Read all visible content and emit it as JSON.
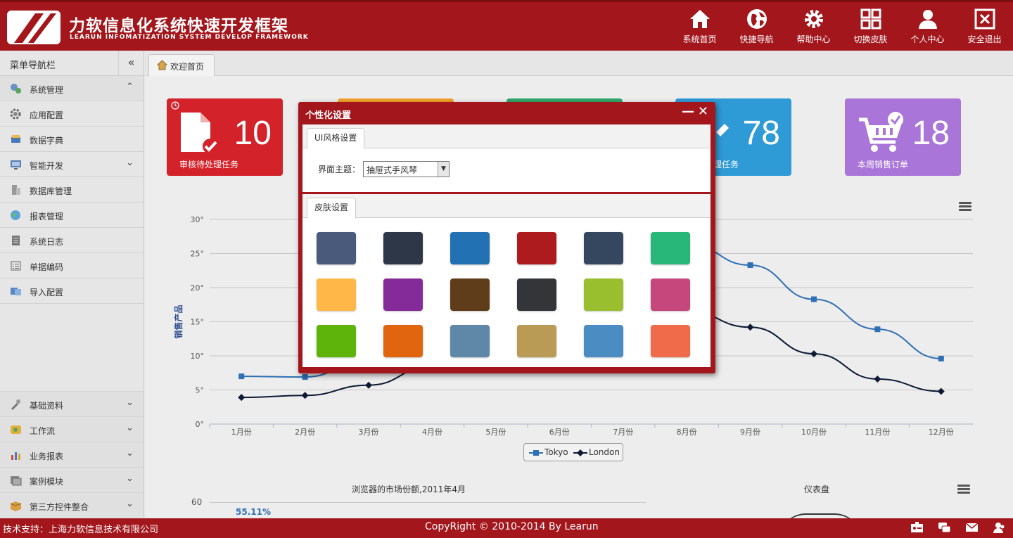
{
  "header": {
    "title": "力软信息化系统快速开发框架",
    "subtitle": "LEARUN INFOMATIZATION SYSTEM DEVELOP FRAMEWORK",
    "nav": [
      {
        "label": "系统首页",
        "icon": "home-icon"
      },
      {
        "label": "快捷导航",
        "icon": "globe-icon"
      },
      {
        "label": "帮助中心",
        "icon": "gear-icon"
      },
      {
        "label": "切换皮肤",
        "icon": "grid-icon"
      },
      {
        "label": "个人中心",
        "icon": "user-icon"
      },
      {
        "label": "安全退出",
        "icon": "exit-icon"
      }
    ]
  },
  "sidebar": {
    "title": "菜单导航栏",
    "collapse_label": "«",
    "items": [
      {
        "label": "系统管理",
        "chevron": "⌃"
      },
      {
        "label": "应用配置",
        "chevron": ""
      },
      {
        "label": "数据字典",
        "chevron": ""
      },
      {
        "label": "智能开发",
        "chevron": "⌄"
      },
      {
        "label": "数据库管理",
        "chevron": ""
      },
      {
        "label": "报表管理",
        "chevron": ""
      },
      {
        "label": "系统日志",
        "chevron": ""
      },
      {
        "label": "单据编码",
        "chevron": ""
      },
      {
        "label": "导入配置",
        "chevron": ""
      }
    ],
    "bottom_items": [
      {
        "label": "基础资料",
        "chevron": "⌄"
      },
      {
        "label": "工作流",
        "chevron": "⌄"
      },
      {
        "label": "业务报表",
        "chevron": "⌄"
      },
      {
        "label": "案例模块",
        "chevron": "⌄"
      },
      {
        "label": "第三方控件整合",
        "chevron": "⌄"
      }
    ]
  },
  "tabs": [
    {
      "label": "欢迎首页"
    }
  ],
  "tiles": [
    {
      "value": "10",
      "caption": "审核待处理任务",
      "color": "#d3222a"
    },
    {
      "value": "78",
      "caption": "更待处理任务",
      "color": "#2e9ad6"
    },
    {
      "value": "18",
      "caption": "本周销售订单",
      "color": "#a975d8"
    }
  ],
  "chart_data": [
    {
      "type": "line",
      "ylabel": "销售产品",
      "ylim": [
        0,
        30
      ],
      "yticks": [
        "0°",
        "5°",
        "10°",
        "15°",
        "20°",
        "25°",
        "30°"
      ],
      "categories": [
        "1月份",
        "2月份",
        "3月份",
        "4月份",
        "5月份",
        "6月份",
        "7月份",
        "8月份",
        "9月份",
        "10月份",
        "11月份",
        "12月份"
      ],
      "series": [
        {
          "name": "Tokyo",
          "color": "#2f6fb5",
          "marker": "square",
          "values": [
            7.0,
            6.9,
            9.5,
            14.5,
            18.2,
            21.5,
            25.2,
            26.5,
            23.3,
            18.3,
            13.9,
            9.6
          ]
        },
        {
          "name": "London",
          "color": "#0d1a33",
          "marker": "diamond",
          "values": [
            3.9,
            4.2,
            5.7,
            8.5,
            11.9,
            15.2,
            17.0,
            16.6,
            14.2,
            10.3,
            6.6,
            4.8
          ]
        }
      ]
    },
    {
      "type": "bar",
      "title": "浏览器的市场份额,2011年4月",
      "yticks": [
        "60"
      ],
      "data_label": "55.11%"
    },
    {
      "type": "gauge",
      "title": "仪表盘"
    }
  ],
  "modal": {
    "title": "个性化设置",
    "minimize": "—",
    "close": "✕",
    "ui_tab": "UI风格设置",
    "theme_label": "界面主题：",
    "theme_value": "抽屉式手风琴",
    "skin_tab": "皮肤设置",
    "swatches": [
      "#4a5a7a",
      "#2d3748",
      "#2271b3",
      "#ae1b1f",
      "#34475f",
      "#28b779",
      "#ffb748",
      "#852b99",
      "#5f3d1a",
      "#333539",
      "#99bf2f",
      "#c6477c",
      "#5eb40a",
      "#e0650e",
      "#5e87a8",
      "#b99b55",
      "#4b8cc3",
      "#f06b4a"
    ]
  },
  "footer": {
    "left": "技术支持：上海力软信息技术有限公司",
    "center": "CopyRight © 2010-2014 By Learun",
    "icons": [
      "id-card-icon",
      "chat-icon",
      "mail-icon",
      "users-icon"
    ]
  }
}
